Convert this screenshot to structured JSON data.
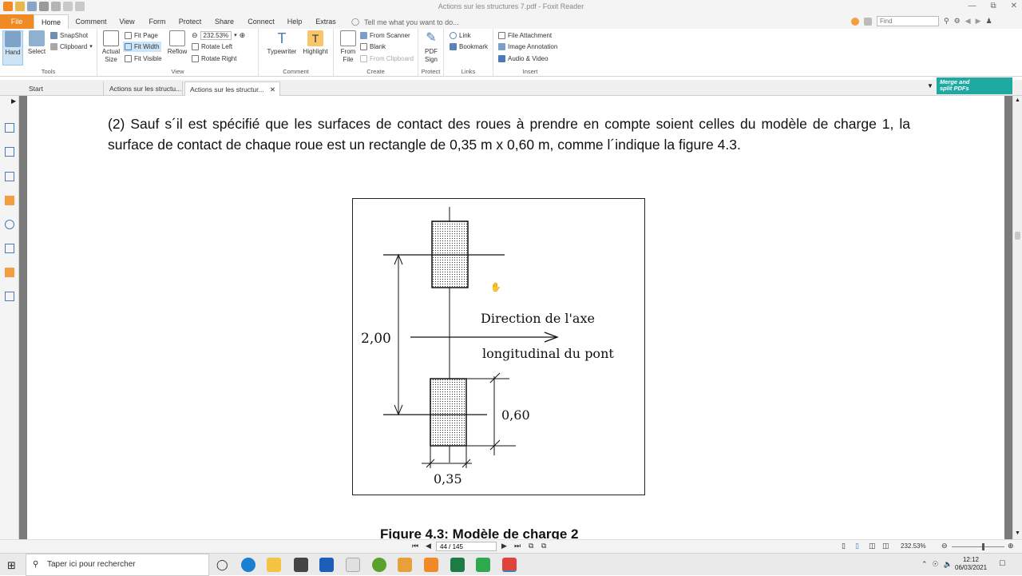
{
  "window": {
    "title": "Actions sur les structures 7.pdf - Foxit Reader"
  },
  "menu": {
    "tabs": [
      "File",
      "Home",
      "Comment",
      "View",
      "Form",
      "Protect",
      "Share",
      "Connect",
      "Help",
      "Extras"
    ],
    "tell_me": "Tell me what you want to do...",
    "find_placeholder": "Find"
  },
  "ribbon": {
    "tools": {
      "label": "Tools",
      "hand": "Hand",
      "select": "Select",
      "snapshot": "SnapShot",
      "clipboard": "Clipboard"
    },
    "view": {
      "label": "View",
      "actual_size_1": "Actual",
      "actual_size_2": "Size",
      "fit_page": "Fit Page",
      "fit_width": "Fit Width",
      "fit_visible": "Fit Visible",
      "reflow": "Reflow",
      "zoom": "232.53%",
      "rotate_left": "Rotate Left",
      "rotate_right": "Rotate Right"
    },
    "comment": {
      "label": "Comment",
      "typewriter": "Typewriter",
      "highlight": "Highlight"
    },
    "create": {
      "label": "Create",
      "from_file_1": "From",
      "from_file_2": "File",
      "from_scanner": "From Scanner",
      "blank": "Blank",
      "from_clipboard": "From Clipboard"
    },
    "protect": {
      "label": "Protect",
      "pdf_sign_1": "PDF",
      "pdf_sign_2": "Sign"
    },
    "links": {
      "label": "Links",
      "link": "Link",
      "bookmark": "Bookmark"
    },
    "insert": {
      "label": "Insert",
      "file_attachment": "File Attachment",
      "image_annotation": "Image Annotation",
      "audio_video": "Audio & Video"
    }
  },
  "doc_tabs": [
    "Start",
    "Actions sur les structu...",
    "Actions sur les structur..."
  ],
  "merge_banner": {
    "line1": "Merge and",
    "line2": "split PDFs"
  },
  "document": {
    "paragraph": "(2)  Sauf s´il  est spécifié  que les surfaces  de contact des roues à prendre  en compte  soient celles du modèle de charge  1, la  surface  de contact  de chaque roue est un rectangle  de 0,35  m  x  0,60  m,  comme  l´indique  la figure 4.3.",
    "figure": {
      "dim_vertical": "2,00",
      "direction_line1": "Direction de l'axe",
      "direction_line2": "longitudinal du pont",
      "dim_height": "0,60",
      "dim_width": "0,35"
    },
    "caption": "Figure 4.3: Modèle  de charge 2"
  },
  "status": {
    "page": "44 / 145",
    "zoom": "232.53%"
  },
  "taskbar": {
    "search_placeholder": "Taper ici pour rechercher",
    "time": "12:12",
    "date": "06/03/2021"
  },
  "colors": {
    "accent_file": "#f08a24",
    "merge_banner": "#1ea9a3",
    "ribbon_active": "#cde4f7",
    "doc_background": "#7b7b7b"
  }
}
